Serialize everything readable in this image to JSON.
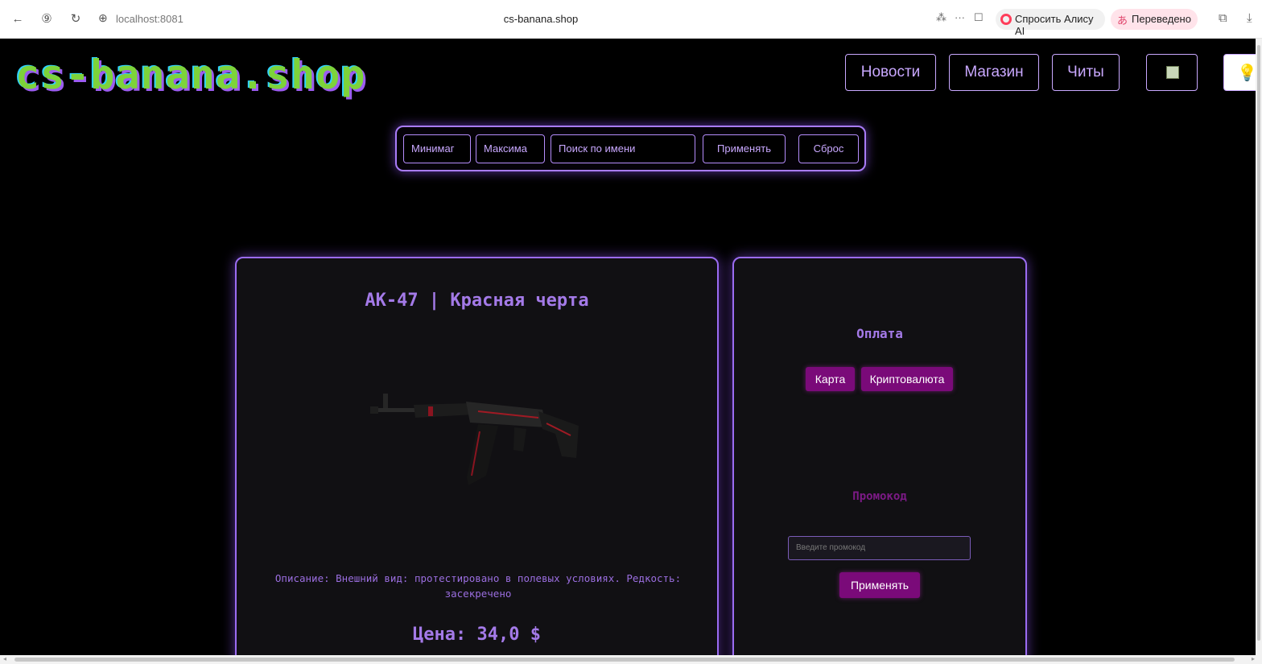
{
  "browser": {
    "url": "localhost:8081",
    "tab_title": "cs-banana.shop",
    "ask_alice": "Спросить Алису AI",
    "translated": "Переведено"
  },
  "header": {
    "logo": "cs-banana.shop",
    "nav": [
      {
        "label": "Новости"
      },
      {
        "label": "Магазин"
      },
      {
        "label": "Читы"
      }
    ]
  },
  "filters": {
    "min_placeholder": "Минимальная",
    "min_display": "Минимаг",
    "max_placeholder": "Максимальная",
    "max_display": "Максима",
    "search_placeholder": "Поиск по имени",
    "apply_label": "Применять",
    "reset_label": "Сброс"
  },
  "product": {
    "title": "AK-47 | Красная черта",
    "description": "Описание: Внешний вид: протестировано в полевых условиях. Редкость: засекречено",
    "price": "Цена: 34,0 $"
  },
  "payment": {
    "title": "Оплата",
    "methods": [
      {
        "label": "Карта"
      },
      {
        "label": "Криптовалюта"
      }
    ],
    "promo_title": "Промокод",
    "promo_placeholder": "Введите промокод",
    "promo_apply": "Применять"
  },
  "colors": {
    "accent": "#a97cf8",
    "button_magenta": "#7a0a79",
    "logo_green": "#7dd33a"
  }
}
